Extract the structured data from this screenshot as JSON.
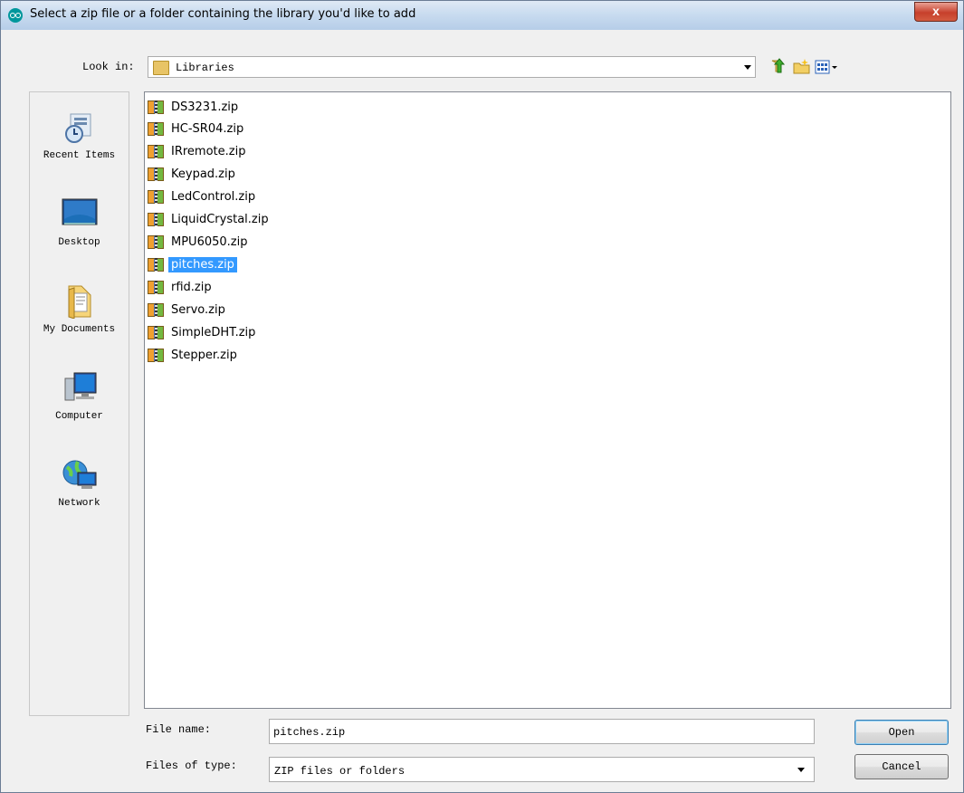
{
  "window": {
    "title": "Select a zip file or a folder containing the library you'd like to add",
    "close_label": "x"
  },
  "look_in": {
    "label": "Look in:",
    "value": "Libraries"
  },
  "toolbar": {
    "up_icon": "up-folder-icon",
    "new_folder_icon": "new-folder-icon",
    "view_icon": "view-menu-icon"
  },
  "places": [
    {
      "label": "Recent Items",
      "icon": "recent-items-icon"
    },
    {
      "label": "Desktop",
      "icon": "desktop-icon"
    },
    {
      "label": "My Documents",
      "icon": "my-documents-icon"
    },
    {
      "label": "Computer",
      "icon": "computer-icon"
    },
    {
      "label": "Network",
      "icon": "network-icon"
    }
  ],
  "files": [
    {
      "name": "DS3231.zip"
    },
    {
      "name": "HC-SR04.zip"
    },
    {
      "name": "IRremote.zip"
    },
    {
      "name": "Keypad.zip"
    },
    {
      "name": "LedControl.zip"
    },
    {
      "name": "LiquidCrystal.zip"
    },
    {
      "name": "MPU6050.zip"
    },
    {
      "name": "pitches.zip",
      "selected": true
    },
    {
      "name": "rfid.zip"
    },
    {
      "name": "Servo.zip"
    },
    {
      "name": "SimpleDHT.zip"
    },
    {
      "name": "Stepper.zip"
    }
  ],
  "file_name": {
    "label": "File name:",
    "value": "pitches.zip"
  },
  "file_type": {
    "label": "Files of type:",
    "value": "ZIP files or folders"
  },
  "buttons": {
    "open": "Open",
    "cancel": "Cancel"
  }
}
